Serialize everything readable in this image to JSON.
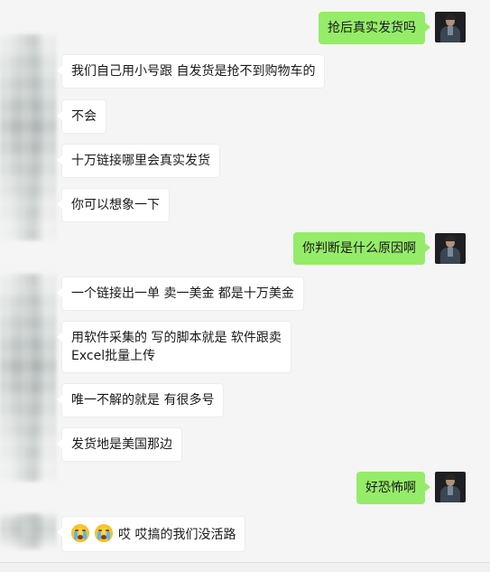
{
  "chat": {
    "messages": [
      {
        "side": "out",
        "text": "抢后真实发货吗"
      },
      {
        "side": "in",
        "text": "我们自己用小号跟 自发货是抢不到购物车的"
      },
      {
        "side": "in",
        "text": "不会"
      },
      {
        "side": "in",
        "text": "十万链接哪里会真实发货"
      },
      {
        "side": "in",
        "text": "你可以想象一下"
      },
      {
        "side": "out",
        "text": "你判断是什么原因啊"
      },
      {
        "side": "in",
        "text": "一个链接出一单 卖一美金 都是十万美金"
      },
      {
        "side": "in",
        "text": "用软件采集的 写的脚本就是 软件跟卖 Excel批量上传"
      },
      {
        "side": "in",
        "text": "唯一不解的就是 有很多号"
      },
      {
        "side": "in",
        "text": "发货地是美国那边"
      },
      {
        "side": "out",
        "text": "好恐怖啊"
      },
      {
        "side": "in",
        "text": "哎 哎搞的我们没活路",
        "emojis": [
          "crying-face-emoji",
          "crying-face-emoji"
        ]
      }
    ]
  },
  "colors": {
    "background": "#f5f5f5",
    "outgoing_bubble": "#95ec69",
    "incoming_bubble": "#ffffff",
    "text": "#191919"
  }
}
